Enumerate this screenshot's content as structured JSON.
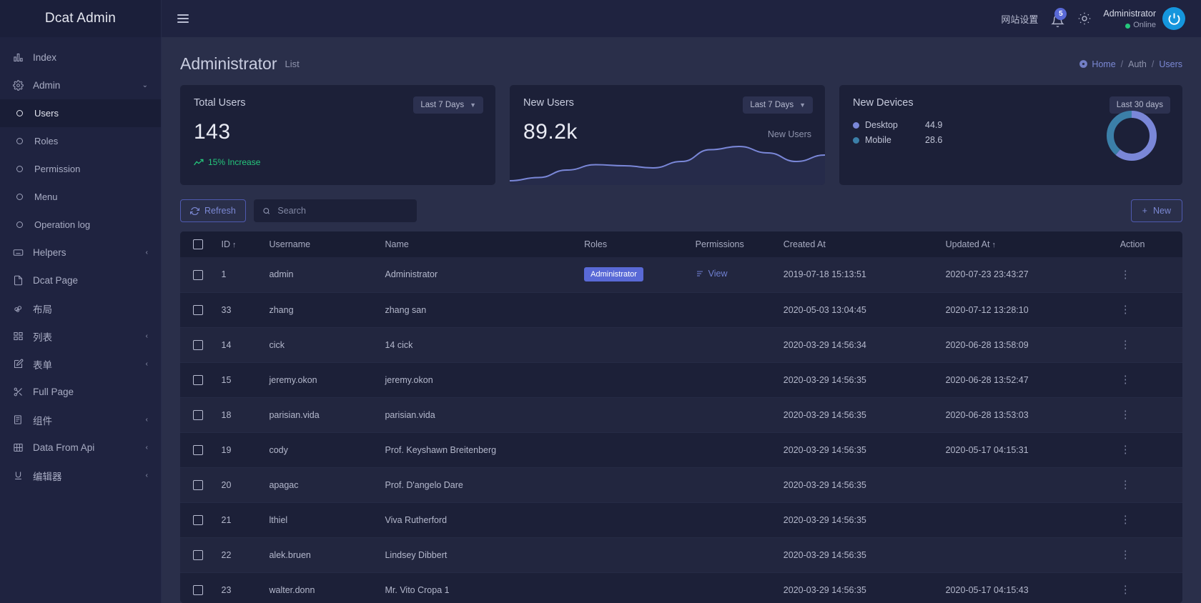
{
  "brand": {
    "title": "Dcat Admin"
  },
  "sidebar": {
    "items": [
      {
        "label": "Index",
        "icon": "chart-bar-icon",
        "type": "top",
        "caret": ""
      },
      {
        "label": "Admin",
        "icon": "gear-icon",
        "type": "top",
        "caret": "⌄"
      },
      {
        "label": "Users",
        "icon": "circle-icon",
        "type": "sub",
        "active": true
      },
      {
        "label": "Roles",
        "icon": "circle-icon",
        "type": "sub"
      },
      {
        "label": "Permission",
        "icon": "circle-icon",
        "type": "sub"
      },
      {
        "label": "Menu",
        "icon": "circle-icon",
        "type": "sub"
      },
      {
        "label": "Operation log",
        "icon": "circle-icon",
        "type": "sub"
      },
      {
        "label": "Helpers",
        "icon": "keyboard-icon",
        "type": "top",
        "caret": "‹"
      },
      {
        "label": "Dcat Page",
        "icon": "file-icon",
        "type": "top",
        "caret": ""
      },
      {
        "label": "布局",
        "icon": "layout-icon",
        "type": "top",
        "caret": ""
      },
      {
        "label": "列表",
        "icon": "grid-icon",
        "type": "top",
        "caret": "‹"
      },
      {
        "label": "表单",
        "icon": "edit-icon",
        "type": "top",
        "caret": "‹"
      },
      {
        "label": "Full Page",
        "icon": "scissors-icon",
        "type": "top",
        "caret": ""
      },
      {
        "label": "组件",
        "icon": "book-icon",
        "type": "top",
        "caret": "‹"
      },
      {
        "label": "Data From Api",
        "icon": "film-icon",
        "type": "top",
        "caret": "‹"
      },
      {
        "label": "编辑器",
        "icon": "underline-icon",
        "type": "top",
        "caret": "‹"
      }
    ]
  },
  "topbar": {
    "site_settings": "网站设置",
    "notification_count": "5",
    "user_name": "Administrator",
    "user_status": "Online"
  },
  "page": {
    "title": "Administrator",
    "subtitle": "List",
    "breadcrumb": {
      "home": "Home",
      "sep1": "/",
      "auth": "Auth",
      "sep2": "/",
      "users": "Users"
    }
  },
  "cards": {
    "total_users": {
      "title": "Total Users",
      "range": "Last 7 Days",
      "value": "143",
      "trend": "15% Increase"
    },
    "new_users": {
      "title": "New Users",
      "range": "Last 7 Days",
      "value": "89.2k",
      "series_label": "New Users"
    },
    "new_devices": {
      "title": "New Devices",
      "range": "Last 30 days",
      "legend": [
        {
          "name": "Desktop",
          "value": "44.9",
          "color": "#7a87d8"
        },
        {
          "name": "Mobile",
          "value": "28.6",
          "color": "#3b7fa8"
        }
      ]
    }
  },
  "chart_data": [
    {
      "type": "area",
      "title": "New Users",
      "x": [
        0,
        1,
        2,
        3,
        4,
        5,
        6,
        7,
        8,
        9,
        10,
        11
      ],
      "values": [
        12,
        15,
        22,
        27,
        26,
        24,
        30,
        41,
        44,
        38,
        30,
        36
      ],
      "ylabel": "",
      "xlabel": "",
      "legend": [
        "New Users"
      ],
      "grid": false
    },
    {
      "type": "pie",
      "title": "New Devices",
      "categories": [
        "Desktop",
        "Mobile"
      ],
      "values": [
        44.9,
        28.6
      ],
      "colors": [
        "#7a87d8",
        "#3b7fa8"
      ],
      "legend_position": "left"
    }
  ],
  "toolbar": {
    "refresh_label": "Refresh",
    "search_placeholder": "Search",
    "search_value": "",
    "new_label": "New",
    "new_plus": "+"
  },
  "table": {
    "columns": [
      {
        "key": "checkbox",
        "label": ""
      },
      {
        "key": "id",
        "label": "ID",
        "sort": "↑"
      },
      {
        "key": "username",
        "label": "Username"
      },
      {
        "key": "name",
        "label": "Name"
      },
      {
        "key": "roles",
        "label": "Roles"
      },
      {
        "key": "permissions",
        "label": "Permissions"
      },
      {
        "key": "created_at",
        "label": "Created At"
      },
      {
        "key": "updated_at",
        "label": "Updated At",
        "sort": "↑"
      },
      {
        "key": "action",
        "label": "Action"
      }
    ],
    "view_label": "View",
    "rows": [
      {
        "id": "1",
        "username": "admin",
        "name": "Administrator",
        "role": "Administrator",
        "permission": "View",
        "created_at": "2019-07-18 15:13:51",
        "updated_at": "2020-07-23 23:43:27"
      },
      {
        "id": "33",
        "username": "zhang",
        "name": "zhang san",
        "role": "",
        "permission": "",
        "created_at": "2020-05-03 13:04:45",
        "updated_at": "2020-07-12 13:28:10"
      },
      {
        "id": "14",
        "username": "cick",
        "name": "14 cick",
        "role": "",
        "permission": "",
        "created_at": "2020-03-29 14:56:34",
        "updated_at": "2020-06-28 13:58:09"
      },
      {
        "id": "15",
        "username": "jeremy.okon",
        "name": "jeremy.okon",
        "role": "",
        "permission": "",
        "created_at": "2020-03-29 14:56:35",
        "updated_at": "2020-06-28 13:52:47"
      },
      {
        "id": "18",
        "username": "parisian.vida",
        "name": "parisian.vida",
        "role": "",
        "permission": "",
        "created_at": "2020-03-29 14:56:35",
        "updated_at": "2020-06-28 13:53:03"
      },
      {
        "id": "19",
        "username": "cody",
        "name": "Prof. Keyshawn Breitenberg",
        "role": "",
        "permission": "",
        "created_at": "2020-03-29 14:56:35",
        "updated_at": "2020-05-17 04:15:31"
      },
      {
        "id": "20",
        "username": "apagac",
        "name": "Prof. D'angelo Dare",
        "role": "",
        "permission": "",
        "created_at": "2020-03-29 14:56:35",
        "updated_at": ""
      },
      {
        "id": "21",
        "username": "lthiel",
        "name": "Viva Rutherford",
        "role": "",
        "permission": "",
        "created_at": "2020-03-29 14:56:35",
        "updated_at": ""
      },
      {
        "id": "22",
        "username": "alek.bruen",
        "name": "Lindsey Dibbert",
        "role": "",
        "permission": "",
        "created_at": "2020-03-29 14:56:35",
        "updated_at": ""
      },
      {
        "id": "23",
        "username": "walter.donn",
        "name": "Mr. Vito Cropa 1",
        "role": "",
        "permission": "",
        "created_at": "2020-03-29 14:56:35",
        "updated_at": "2020-05-17 04:15:43"
      }
    ]
  }
}
